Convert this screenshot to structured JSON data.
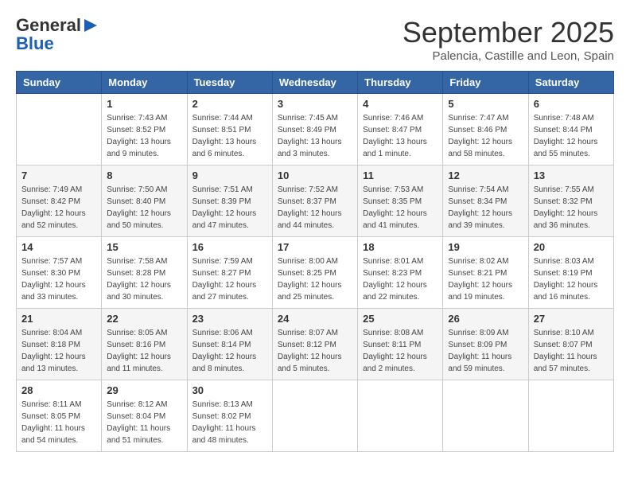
{
  "header": {
    "logo_line1": "General",
    "logo_line2": "Blue",
    "month_title": "September 2025",
    "location": "Palencia, Castille and Leon, Spain"
  },
  "days_of_week": [
    "Sunday",
    "Monday",
    "Tuesday",
    "Wednesday",
    "Thursday",
    "Friday",
    "Saturday"
  ],
  "weeks": [
    [
      {
        "day": "",
        "info": ""
      },
      {
        "day": "1",
        "info": "Sunrise: 7:43 AM\nSunset: 8:52 PM\nDaylight: 13 hours\nand 9 minutes."
      },
      {
        "day": "2",
        "info": "Sunrise: 7:44 AM\nSunset: 8:51 PM\nDaylight: 13 hours\nand 6 minutes."
      },
      {
        "day": "3",
        "info": "Sunrise: 7:45 AM\nSunset: 8:49 PM\nDaylight: 13 hours\nand 3 minutes."
      },
      {
        "day": "4",
        "info": "Sunrise: 7:46 AM\nSunset: 8:47 PM\nDaylight: 13 hours\nand 1 minute."
      },
      {
        "day": "5",
        "info": "Sunrise: 7:47 AM\nSunset: 8:46 PM\nDaylight: 12 hours\nand 58 minutes."
      },
      {
        "day": "6",
        "info": "Sunrise: 7:48 AM\nSunset: 8:44 PM\nDaylight: 12 hours\nand 55 minutes."
      }
    ],
    [
      {
        "day": "7",
        "info": "Sunrise: 7:49 AM\nSunset: 8:42 PM\nDaylight: 12 hours\nand 52 minutes."
      },
      {
        "day": "8",
        "info": "Sunrise: 7:50 AM\nSunset: 8:40 PM\nDaylight: 12 hours\nand 50 minutes."
      },
      {
        "day": "9",
        "info": "Sunrise: 7:51 AM\nSunset: 8:39 PM\nDaylight: 12 hours\nand 47 minutes."
      },
      {
        "day": "10",
        "info": "Sunrise: 7:52 AM\nSunset: 8:37 PM\nDaylight: 12 hours\nand 44 minutes."
      },
      {
        "day": "11",
        "info": "Sunrise: 7:53 AM\nSunset: 8:35 PM\nDaylight: 12 hours\nand 41 minutes."
      },
      {
        "day": "12",
        "info": "Sunrise: 7:54 AM\nSunset: 8:34 PM\nDaylight: 12 hours\nand 39 minutes."
      },
      {
        "day": "13",
        "info": "Sunrise: 7:55 AM\nSunset: 8:32 PM\nDaylight: 12 hours\nand 36 minutes."
      }
    ],
    [
      {
        "day": "14",
        "info": "Sunrise: 7:57 AM\nSunset: 8:30 PM\nDaylight: 12 hours\nand 33 minutes."
      },
      {
        "day": "15",
        "info": "Sunrise: 7:58 AM\nSunset: 8:28 PM\nDaylight: 12 hours\nand 30 minutes."
      },
      {
        "day": "16",
        "info": "Sunrise: 7:59 AM\nSunset: 8:27 PM\nDaylight: 12 hours\nand 27 minutes."
      },
      {
        "day": "17",
        "info": "Sunrise: 8:00 AM\nSunset: 8:25 PM\nDaylight: 12 hours\nand 25 minutes."
      },
      {
        "day": "18",
        "info": "Sunrise: 8:01 AM\nSunset: 8:23 PM\nDaylight: 12 hours\nand 22 minutes."
      },
      {
        "day": "19",
        "info": "Sunrise: 8:02 AM\nSunset: 8:21 PM\nDaylight: 12 hours\nand 19 minutes."
      },
      {
        "day": "20",
        "info": "Sunrise: 8:03 AM\nSunset: 8:19 PM\nDaylight: 12 hours\nand 16 minutes."
      }
    ],
    [
      {
        "day": "21",
        "info": "Sunrise: 8:04 AM\nSunset: 8:18 PM\nDaylight: 12 hours\nand 13 minutes."
      },
      {
        "day": "22",
        "info": "Sunrise: 8:05 AM\nSunset: 8:16 PM\nDaylight: 12 hours\nand 11 minutes."
      },
      {
        "day": "23",
        "info": "Sunrise: 8:06 AM\nSunset: 8:14 PM\nDaylight: 12 hours\nand 8 minutes."
      },
      {
        "day": "24",
        "info": "Sunrise: 8:07 AM\nSunset: 8:12 PM\nDaylight: 12 hours\nand 5 minutes."
      },
      {
        "day": "25",
        "info": "Sunrise: 8:08 AM\nSunset: 8:11 PM\nDaylight: 12 hours\nand 2 minutes."
      },
      {
        "day": "26",
        "info": "Sunrise: 8:09 AM\nSunset: 8:09 PM\nDaylight: 11 hours\nand 59 minutes."
      },
      {
        "day": "27",
        "info": "Sunrise: 8:10 AM\nSunset: 8:07 PM\nDaylight: 11 hours\nand 57 minutes."
      }
    ],
    [
      {
        "day": "28",
        "info": "Sunrise: 8:11 AM\nSunset: 8:05 PM\nDaylight: 11 hours\nand 54 minutes."
      },
      {
        "day": "29",
        "info": "Sunrise: 8:12 AM\nSunset: 8:04 PM\nDaylight: 11 hours\nand 51 minutes."
      },
      {
        "day": "30",
        "info": "Sunrise: 8:13 AM\nSunset: 8:02 PM\nDaylight: 11 hours\nand 48 minutes."
      },
      {
        "day": "",
        "info": ""
      },
      {
        "day": "",
        "info": ""
      },
      {
        "day": "",
        "info": ""
      },
      {
        "day": "",
        "info": ""
      }
    ]
  ]
}
